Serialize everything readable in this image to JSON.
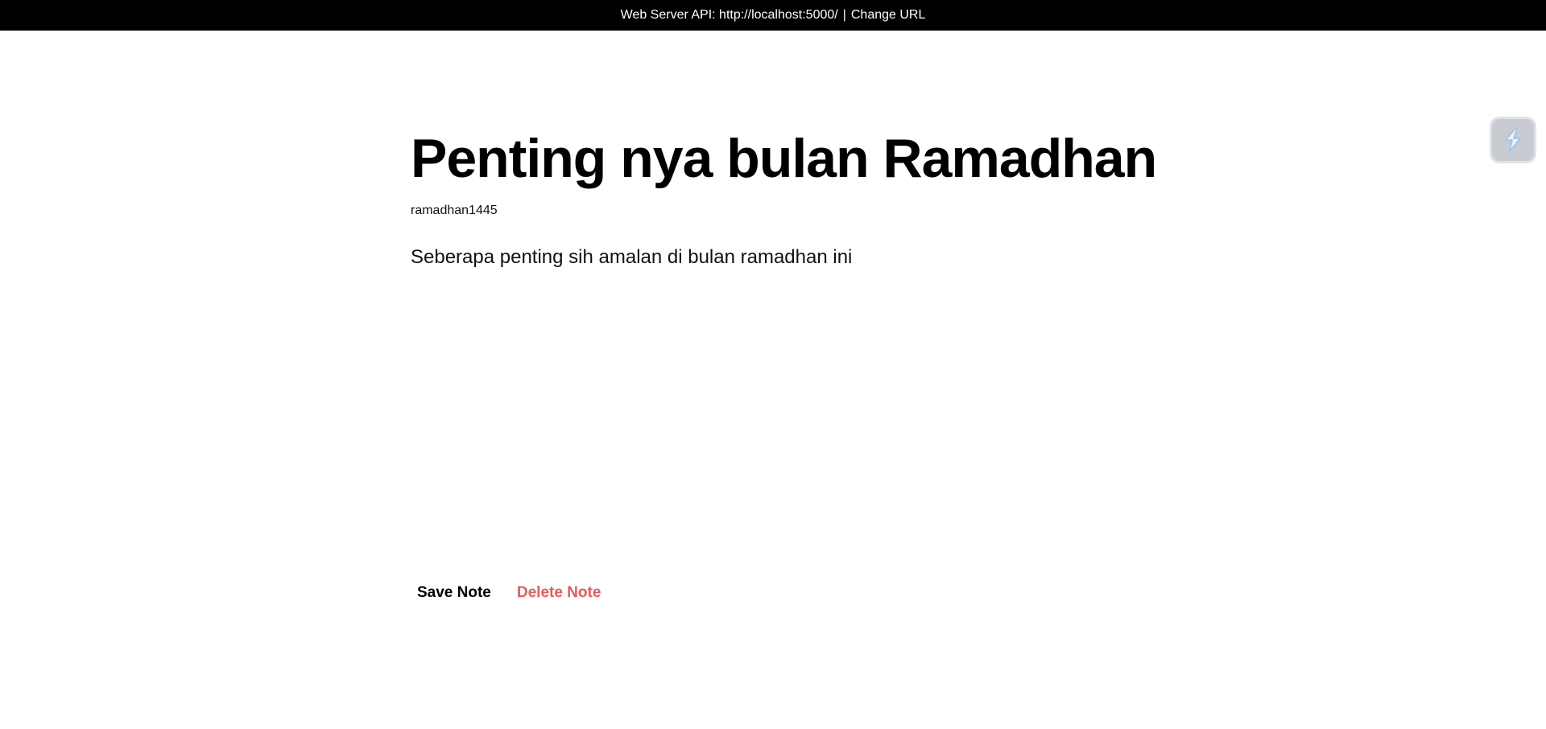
{
  "topbar": {
    "api_label": "Web Server API: http://localhost:5000/",
    "separator": "|",
    "change_url": "Change URL"
  },
  "note": {
    "title": "Penting nya bulan Ramadhan",
    "owner": "ramadhan1445",
    "body": "Seberapa penting sih amalan di bulan ramadhan ini"
  },
  "actions": {
    "save_label": "Save Note",
    "delete_label": "Delete Note"
  },
  "widget": {
    "icon": "bolt-icon"
  },
  "colors": {
    "topbar_bg": "#000000",
    "delete": "#e85a5a",
    "widget_bg": "#c8cbd1"
  }
}
